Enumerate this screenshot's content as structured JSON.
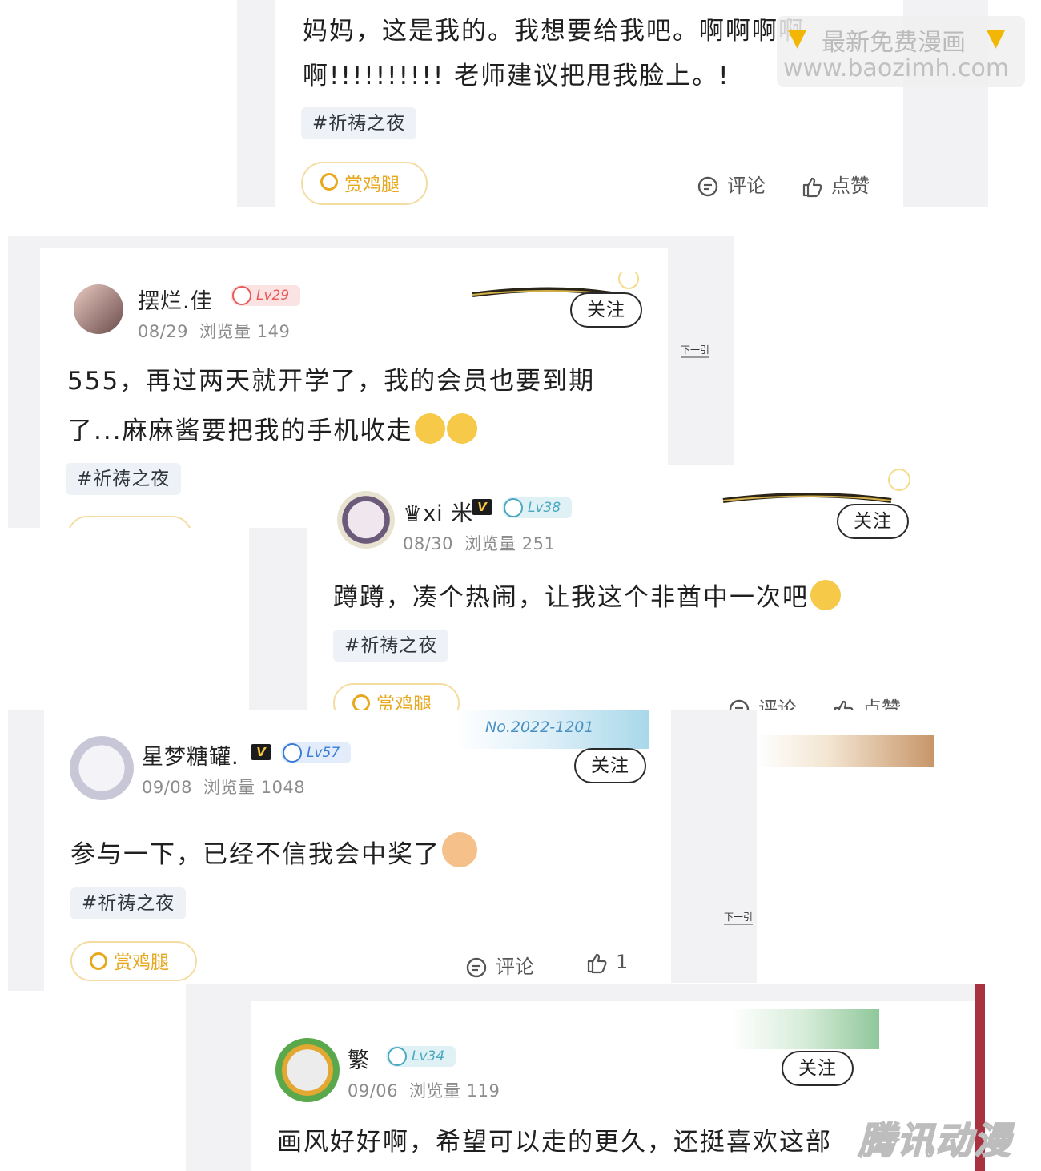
{
  "watermark": {
    "line1": "最新免费漫画",
    "line2": "www.baozimh.com"
  },
  "corner_logo": "腾讯动漫",
  "common": {
    "follow_label": "关注",
    "reward_label": "赏鸡腿",
    "comment_label": "评论",
    "like_label": "点赞",
    "views_label": "浏览量",
    "next_hint": "下一引"
  },
  "posts": [
    {
      "body_lines": [
        "妈妈，这是我的。我想要给我吧。啊啊啊啊",
        "啊!!!!!!!!!! 老师建议把甩我脸上。!"
      ],
      "tag": "#祈祷之夜"
    },
    {
      "username": "摆烂.佳",
      "level": "Lv29",
      "date": "08/29",
      "views": "149",
      "body_lines": [
        "555，再过两天就开学了，我的会员也要到期",
        "了...麻麻酱要把我的手机收走"
      ],
      "tag": "#祈祷之夜"
    },
    {
      "username": "♛xi 米",
      "level": "Lv38",
      "date": "08/30",
      "views": "251",
      "body_lines": [
        "蹲蹲，凑个热闹，让我这个非酋中一次吧"
      ],
      "tag": "#祈祷之夜"
    },
    {
      "username": "星梦糖罐.",
      "level": "Lv57",
      "date": "09/08",
      "views": "1048",
      "banner_text": "No.2022-1201",
      "body_lines": [
        "参与一下，已经不信我会中奖了"
      ],
      "tag": "#祈祷之夜",
      "like_count": "1"
    },
    {
      "username": "繁",
      "level": "Lv34",
      "date": "09/06",
      "views": "119",
      "body_lines": [
        "画风好好啊，希望可以走的更久，还挺喜欢这部"
      ]
    }
  ],
  "colors": {
    "reward": "#e7a81e",
    "lv29": "#e85a5a",
    "lv38": "#4aa8c0",
    "lv57": "#3a7bd5",
    "lv34": "#4aa8c0"
  }
}
